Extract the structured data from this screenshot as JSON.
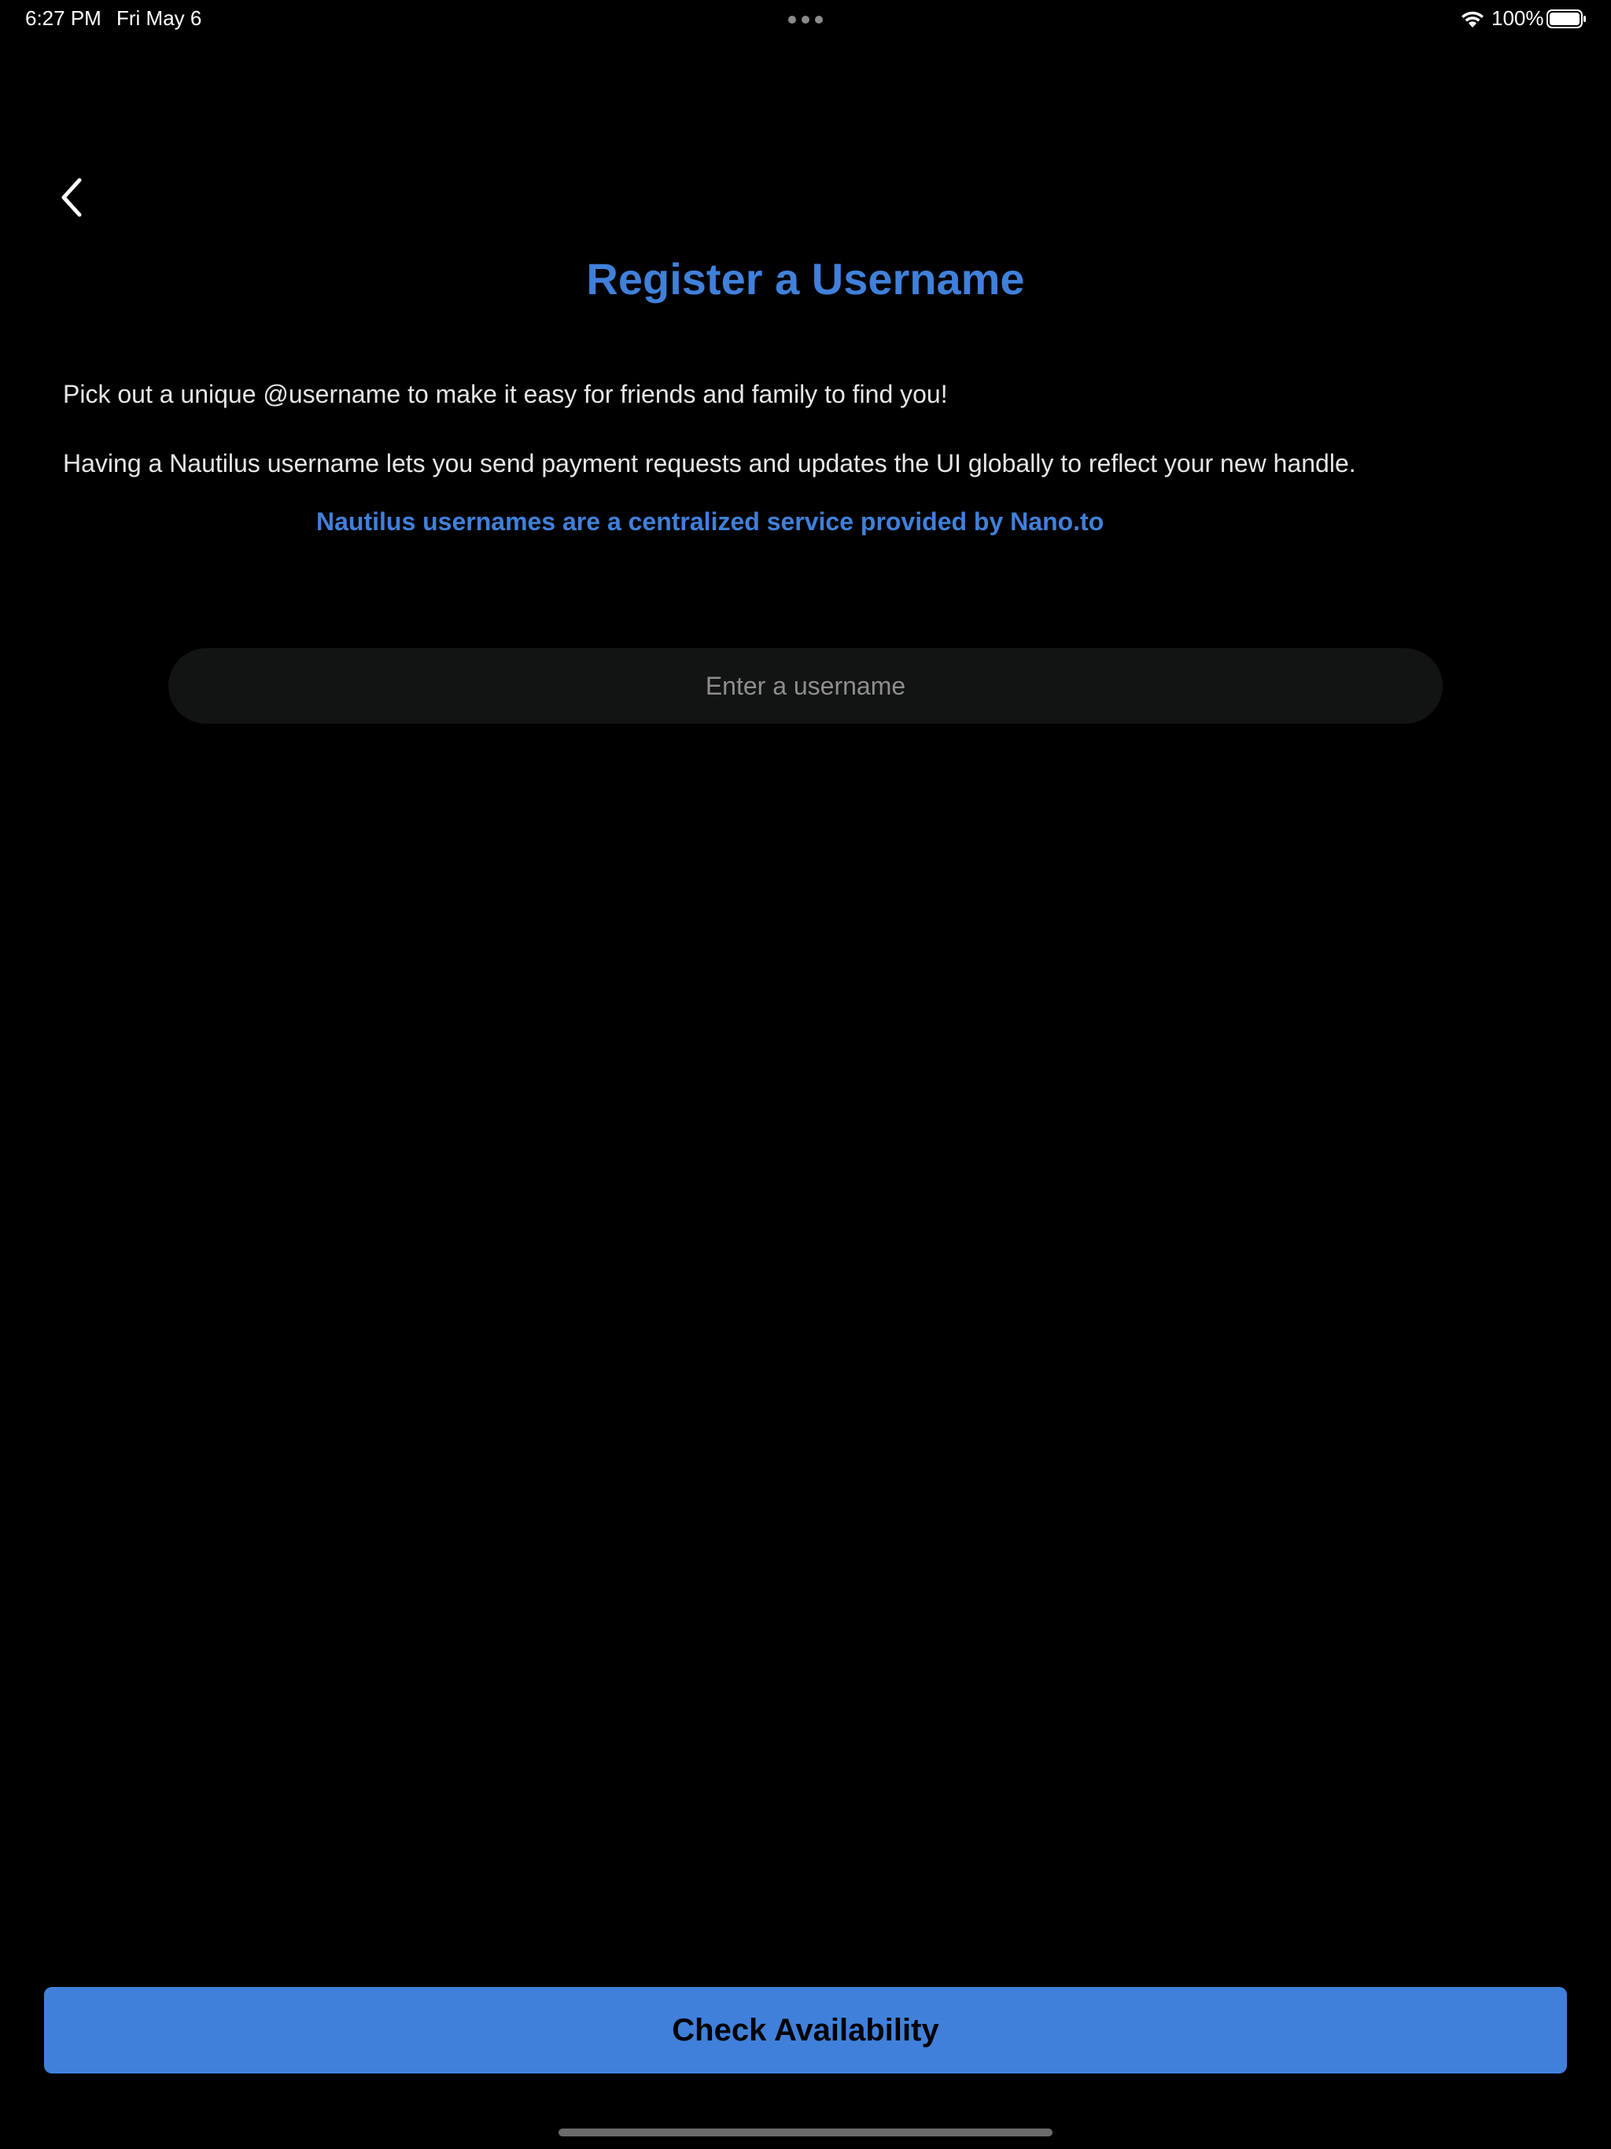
{
  "status_bar": {
    "time": "6:27 PM",
    "date": "Fri May 6",
    "battery_percent": "100%",
    "wifi_icon": "wifi-icon",
    "battery_icon": "battery-full-icon",
    "multitask_icon": "three-dots-icon"
  },
  "nav": {
    "back_icon": "chevron-left-icon"
  },
  "page": {
    "title": "Register a Username",
    "description_1": "Pick out a unique @username to make it easy for friends and family to find you!",
    "description_2": "Having a Nautilus username lets you send payment requests and updates the UI globally to reflect your new handle.",
    "provider_note": "Nautilus usernames are a centralized service provided by Nano.to"
  },
  "form": {
    "username_value": "",
    "username_placeholder": "Enter a username"
  },
  "actions": {
    "check_availability_label": "Check Availability"
  },
  "colors": {
    "background": "#000000",
    "accent": "#4080da",
    "input_background": "#121313",
    "text": "#e6e6e6",
    "placeholder": "#8e8e8e"
  }
}
